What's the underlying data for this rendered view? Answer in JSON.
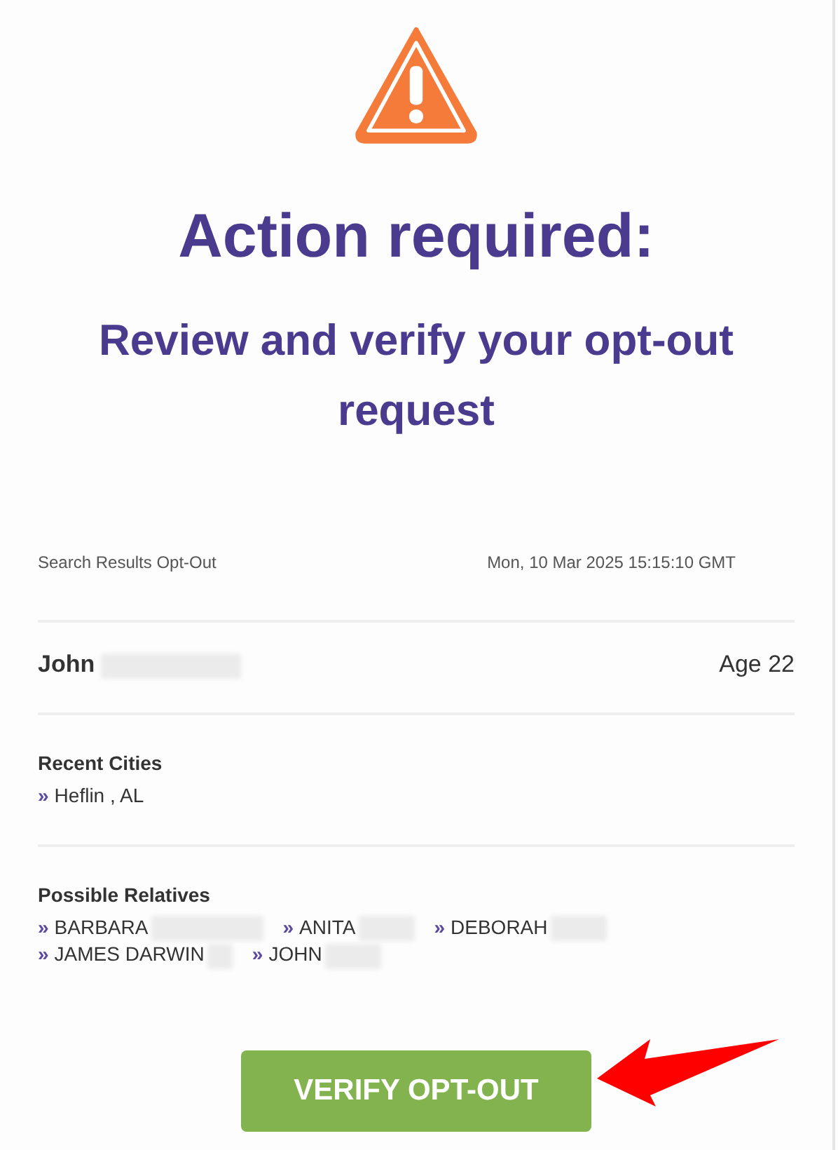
{
  "heading": "Action required:",
  "subheading": "Review and verify your opt-out request",
  "meta": {
    "label": "Search Results Opt-Out",
    "date": "Mon, 10 Mar 2025 15:15:10 GMT"
  },
  "person": {
    "name": "John",
    "age": "Age 22"
  },
  "recent_cities": {
    "title": "Recent Cities",
    "items": [
      {
        "bullet": "»",
        "text": "Heflin , AL"
      }
    ]
  },
  "possible_relatives": {
    "title": "Possible Relatives",
    "items": [
      {
        "bullet": "»",
        "text": "BARBARA"
      },
      {
        "bullet": "»",
        "text": "ANITA"
      },
      {
        "bullet": "»",
        "text": "DEBORAH"
      },
      {
        "bullet": "»",
        "text": "JAMES DARWIN"
      },
      {
        "bullet": "»",
        "text": "JOHN"
      }
    ]
  },
  "button": {
    "label": "VERIFY OPT-OUT"
  }
}
